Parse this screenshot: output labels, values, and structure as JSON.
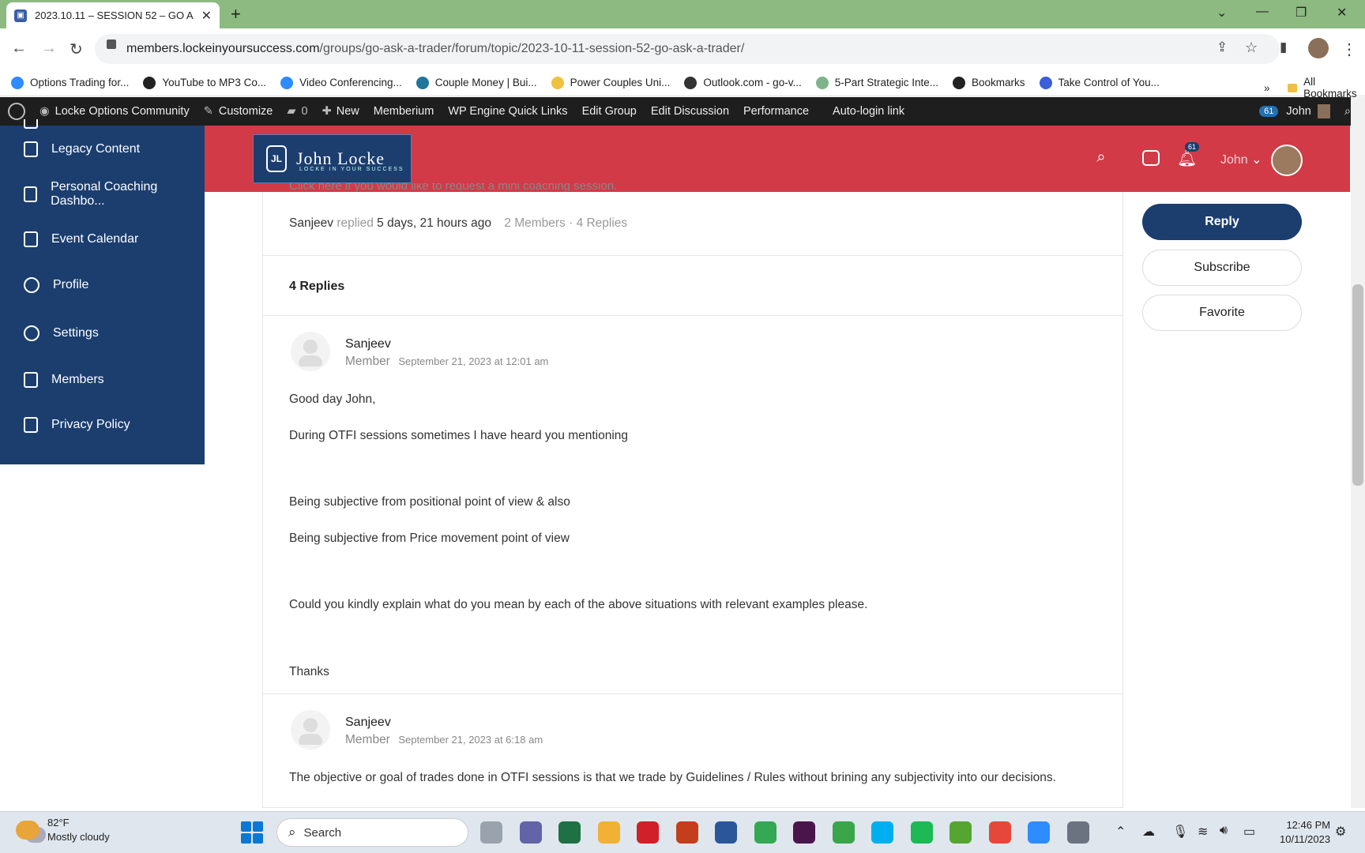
{
  "browser": {
    "tab_title": "2023.10.11 – SESSION 52 – GO A",
    "url_host": "members.lockeinyoursuccess.com",
    "url_path": "/groups/go-ask-a-trader/forum/topic/2023-10-11-session-52-go-ask-a-trader/",
    "bookmarks": [
      {
        "label": "Options Trading for...",
        "icon": "zoom-icon",
        "color": "#2d8cff"
      },
      {
        "label": "YouTube to MP3 Co...",
        "icon": "music-note-icon",
        "color": "#222222"
      },
      {
        "label": "Video Conferencing...",
        "icon": "zoom-icon",
        "color": "#2d8cff"
      },
      {
        "label": "Couple Money | Bui...",
        "icon": "wordpress-icon",
        "color": "#21759b"
      },
      {
        "label": "Power Couples Uni...",
        "icon": "bookmark-page-icon",
        "color": "#f0c040"
      },
      {
        "label": "Outlook.com - go-v...",
        "icon": "globe-icon",
        "color": "#333333"
      },
      {
        "label": "5-Part Strategic Inte...",
        "icon": "circle-icon",
        "color": "#7fb38a"
      },
      {
        "label": "Bookmarks",
        "icon": "star-icon",
        "color": "#222222"
      },
      {
        "label": "Take Control of You...",
        "icon": "play-icon",
        "color": "#3a5fd8"
      }
    ],
    "all_bookmarks": "All Bookmarks",
    "overflow": "»"
  },
  "wp_admin": {
    "items": [
      "Locke Options Community",
      "Customize",
      "0",
      "New",
      "Memberium",
      "WP Engine Quick Links",
      "Edit Group",
      "Edit Discussion",
      "Performance",
      "Auto-login link"
    ],
    "badge": "61",
    "user": "John"
  },
  "sidebar": {
    "items": [
      {
        "label": "Legacy Content",
        "icon": "page-icon"
      },
      {
        "label": "Personal Coaching Dashbo...",
        "icon": "page-icon"
      },
      {
        "label": "Event Calendar",
        "icon": "page-icon"
      },
      {
        "label": "Profile",
        "icon": "user-icon"
      },
      {
        "label": "Settings",
        "icon": "gear-icon"
      },
      {
        "label": "Members",
        "icon": "page-icon"
      },
      {
        "label": "Privacy Policy",
        "icon": "page-icon"
      }
    ]
  },
  "header": {
    "logo_initials": "JL",
    "logo_name": "John Locke",
    "logo_tagline": "LOCKE IN YOUR SUCCESS",
    "notif_count": "61",
    "user": "John"
  },
  "topic": {
    "cut_text": "Click here if you would like to request a mini coaching session.",
    "meta_author": "Sanjeev",
    "meta_replied": "replied",
    "meta_time": "5 days, 21 hours ago",
    "meta_counts": "2 Members · 4 Replies",
    "replies_heading": "4 Replies"
  },
  "posts": [
    {
      "author": "Sanjeev",
      "role": "Member",
      "date": "September 21, 2023 at 12:01 am",
      "paragraphs": [
        "Good day John,",
        "During OTFI sessions sometimes I have heard you mentioning",
        "Being subjective from positional point of view & also",
        "Being subjective from Price movement point of view",
        "Could you kindly explain what do you mean by each of the above situations with relevant examples please.",
        "Thanks"
      ]
    },
    {
      "author": "Sanjeev",
      "role": "Member",
      "date": "September 21, 2023 at 6:18 am",
      "paragraphs": [
        "The objective or goal of trades done in OTFI sessions is that we trade by Guidelines / Rules without brining any subjectivity into our decisions."
      ]
    }
  ],
  "actions": {
    "reply": "Reply",
    "subscribe": "Subscribe",
    "favorite": "Favorite"
  },
  "taskbar": {
    "temp": "82°F",
    "condition": "Mostly cloudy",
    "search_placeholder": "Search",
    "time": "12:46 PM",
    "date": "10/11/2023"
  }
}
